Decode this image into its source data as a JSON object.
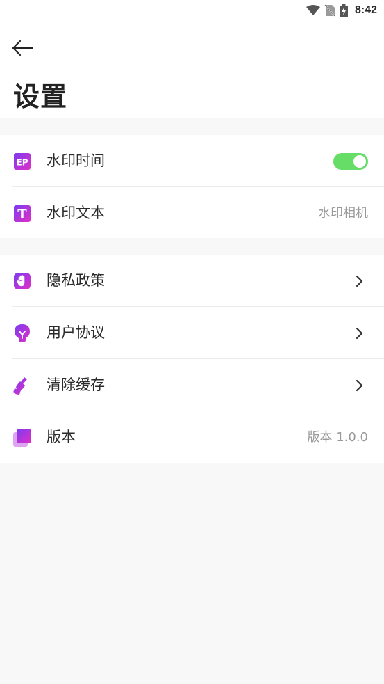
{
  "status_bar": {
    "time": "8:42"
  },
  "header": {
    "title": "设置"
  },
  "groups": [
    {
      "items": [
        {
          "label": "水印时间",
          "icon": "watermark-time-icon",
          "toggle_on": true
        },
        {
          "label": "水印文本",
          "icon": "text-t-icon",
          "value": "水印相机"
        }
      ]
    },
    {
      "items": [
        {
          "label": "隐私政策",
          "icon": "hand-shield-icon"
        },
        {
          "label": "用户协议",
          "icon": "lightbulb-icon"
        },
        {
          "label": "清除缓存",
          "icon": "broom-icon"
        },
        {
          "label": "版本",
          "icon": "layers-icon",
          "value": "版本 1.0.0"
        }
      ]
    }
  ],
  "colors": {
    "accent_start": "#7b3cf0",
    "accent_end": "#e02fc7",
    "toggle_on": "#66dd66"
  }
}
